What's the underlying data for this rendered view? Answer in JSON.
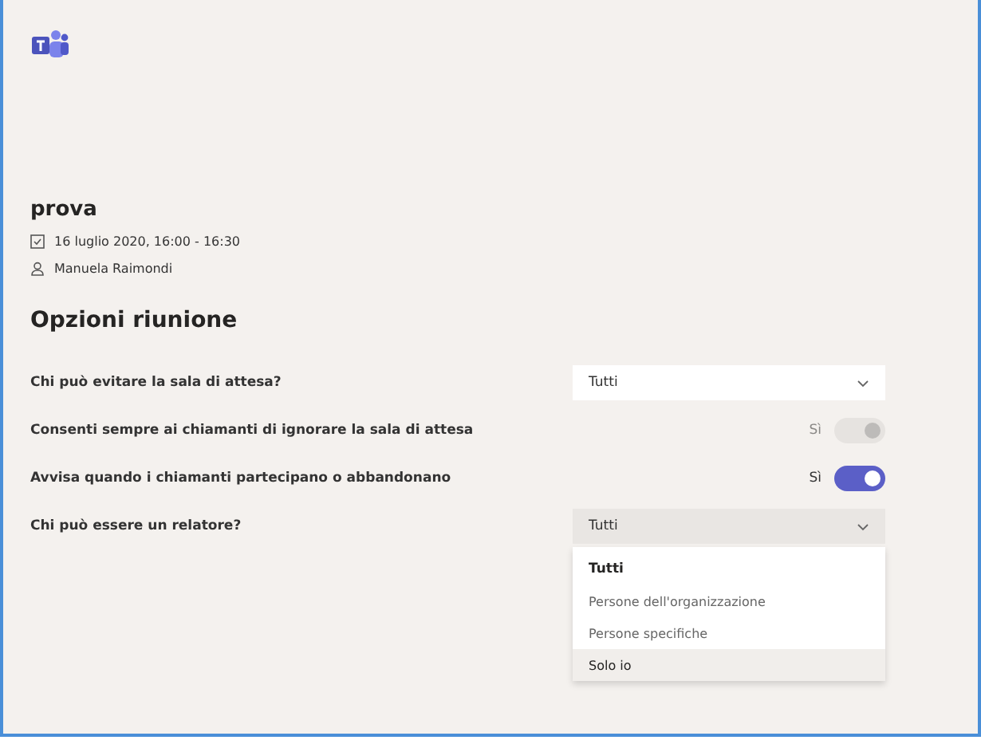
{
  "meeting": {
    "title": "prova",
    "date": "16 luglio 2020, 16:00 - 16:30",
    "organizer": "Manuela Raimondi"
  },
  "section_title": "Opzioni riunione",
  "options": [
    {
      "kind": "dropdown",
      "label": "Chi può evitare la sala di attesa?",
      "value": "Tutti",
      "expanded": false
    },
    {
      "kind": "toggle",
      "label": "Consenti sempre ai chiamanti di ignorare la sala di attesa",
      "state_label": "Sì",
      "on": true,
      "disabled": true
    },
    {
      "kind": "toggle",
      "label": "Avvisa quando i chiamanti partecipano o abbandonano",
      "state_label": "Sì",
      "on": true,
      "disabled": false
    },
    {
      "kind": "dropdown",
      "label": "Chi può essere un relatore?",
      "value": "Tutti",
      "expanded": true,
      "menu": [
        {
          "label": "Tutti",
          "selected": true,
          "highlighted": false
        },
        {
          "label": "Persone dell'organizzazione",
          "selected": false,
          "highlighted": false
        },
        {
          "label": "Persone specifiche",
          "selected": false,
          "highlighted": false
        },
        {
          "label": "Solo io",
          "selected": false,
          "highlighted": true
        }
      ]
    }
  ]
}
